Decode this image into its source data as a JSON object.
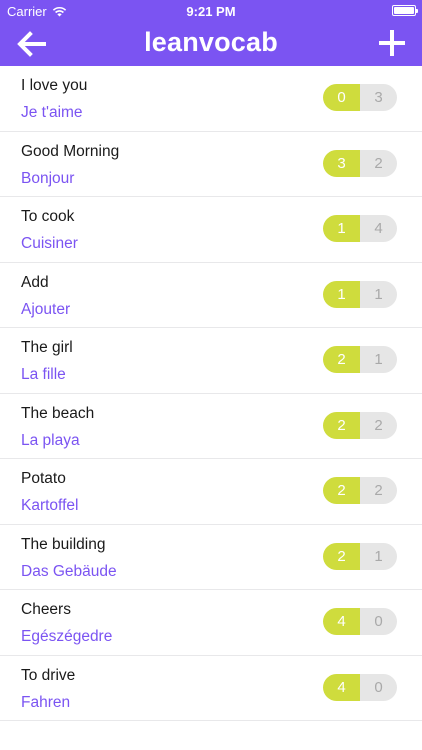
{
  "status_bar": {
    "carrier": "Carrier",
    "time": "9:21 PM"
  },
  "nav": {
    "title": "leanvocab",
    "back_icon": "arrow-left-icon",
    "add_icon": "plus-icon"
  },
  "colors": {
    "brand": "#7b54f2",
    "correct": "#cfdc3d",
    "wrong": "#e6e6e6"
  },
  "words": [
    {
      "term": "I love you",
      "translation": "Je t'aime",
      "correct": "0",
      "wrong": "3"
    },
    {
      "term": "Good Morning",
      "translation": "Bonjour",
      "correct": "3",
      "wrong": "2"
    },
    {
      "term": "To cook",
      "translation": "Cuisiner",
      "correct": "1",
      "wrong": "4"
    },
    {
      "term": "Add",
      "translation": "Ajouter",
      "correct": "1",
      "wrong": "1"
    },
    {
      "term": "The girl",
      "translation": "La fille",
      "correct": "2",
      "wrong": "1"
    },
    {
      "term": "The beach",
      "translation": "La playa",
      "correct": "2",
      "wrong": "2"
    },
    {
      "term": "Potato",
      "translation": "Kartoffel",
      "correct": "2",
      "wrong": "2"
    },
    {
      "term": "The building",
      "translation": "Das Gebäude",
      "correct": "2",
      "wrong": "1"
    },
    {
      "term": "Cheers",
      "translation": "Egészégedre",
      "correct": "4",
      "wrong": "0"
    },
    {
      "term": "To drive",
      "translation": "Fahren",
      "correct": "4",
      "wrong": "0"
    }
  ]
}
